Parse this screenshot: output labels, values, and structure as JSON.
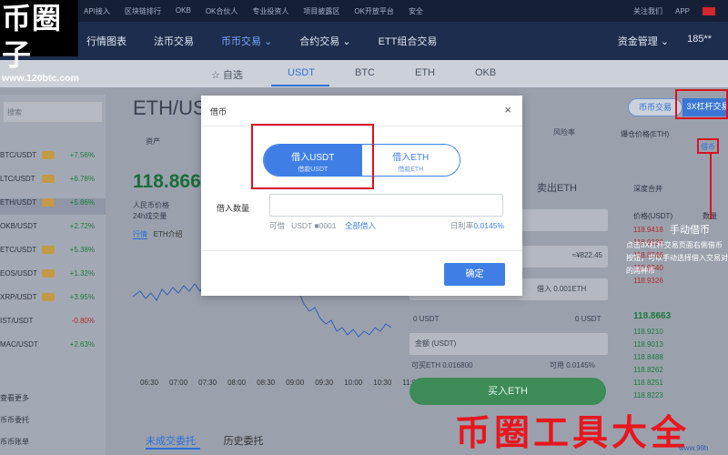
{
  "logo": {
    "big": "币圈子",
    "url": "www.120btc.com"
  },
  "topbar": {
    "links": [
      "API接入",
      "区块链排行",
      "OKB",
      "OK合伙人",
      "专业投资人",
      "项目披露区",
      "OK开放平台",
      "安全"
    ],
    "right": [
      "关注我们",
      "APP"
    ]
  },
  "nav": {
    "items": [
      "行情图表",
      "法币交易",
      "币币交易 ⌄",
      "合约交易 ⌄",
      "ETT组合交易"
    ],
    "active_index": 2,
    "right": [
      "资金管理 ⌄",
      "185**"
    ]
  },
  "subtabs": {
    "items": [
      "☆ 自选",
      "USDT",
      "BTC",
      "ETH",
      "OKB"
    ],
    "active_index": 1
  },
  "left": {
    "search": "搜索",
    "pairs": [
      {
        "name": "BTC/USDT",
        "badge": "3X",
        "change": "+7.56%",
        "dir": "up"
      },
      {
        "name": "LTC/USDT",
        "badge": "3X",
        "change": "+6.78%",
        "dir": "up"
      },
      {
        "name": "ETH/USDT",
        "badge": "3X",
        "change": "+5.86%",
        "dir": "up"
      },
      {
        "name": "OKB/USDT",
        "badge": "",
        "change": "+2.72%",
        "dir": "up"
      },
      {
        "name": "ETC/USDT",
        "badge": "3X",
        "change": "+5.38%",
        "dir": "up"
      },
      {
        "name": "EOS/USDT",
        "badge": "3X",
        "change": "+1.32%",
        "dir": "up"
      },
      {
        "name": "XRP/USDT",
        "badge": "3X",
        "change": "+3.95%",
        "dir": "up"
      },
      {
        "name": "IST/USDT",
        "badge": "",
        "change": "-0.80%",
        "dir": "dn"
      },
      {
        "name": "MAC/USDT",
        "badge": "",
        "change": "+2.63%",
        "dir": "up"
      }
    ],
    "bottom": [
      "查看更多",
      "币币委托",
      "币币账单"
    ]
  },
  "center": {
    "pair": "ETH/US",
    "label_asset": "资产",
    "price": "118.866",
    "label_rmb": "人民币价格",
    "label_vol": "24h成交量",
    "chart_tabs": [
      "行情",
      "ETH介绍"
    ],
    "times": [
      "06:30",
      "07:00",
      "07:30",
      "08:00",
      "08:30",
      "09:00",
      "09:30",
      "10:00",
      "10:30",
      "11:0"
    ],
    "bottom_tabs": [
      "未成交委托",
      "历史委托"
    ]
  },
  "right": {
    "risk": "风险率",
    "sell": "卖出ETH",
    "price": "≈¥822.45",
    "borrow_hint": "借入 0.001ETH",
    "usdt_line": "0 USDT",
    "usdt_line2": "0 USDT",
    "amount": "金额 (USDT)",
    "avail": "可买ETH 0.016800",
    "avail2": "可用 0.0145%",
    "buy": "买入ETH"
  },
  "far_right": {
    "pill_coin": "币币交易",
    "pill_lev": "3X杠杆交易",
    "explode": "爆仓价格(ETH)",
    "borrow_tag": "借币",
    "merge": "深度合并",
    "col_price": "价格(USDT)",
    "col_amt": "数量",
    "asks": [
      "118.9418",
      "118.9338",
      "118.8746",
      "118.9340",
      "118.9326"
    ],
    "mid": "118.8663",
    "bids": [
      "118.9210",
      "118.9013",
      "118.8488",
      "118.8262",
      "118.8251",
      "118.8223"
    ],
    "annot_title": "手动借币",
    "annot_text": "点击3X杠杆交易页面右侧借币按钮，可以手动选择借入交易对的两种币"
  },
  "modal": {
    "title": "借币",
    "close": "×",
    "opt1_main": "借入USDT",
    "opt1_sub": "借款USDT",
    "opt2_main": "借入ETH",
    "opt2_sub": "借款ETH",
    "amount_label": "借入数量",
    "amount_value": "",
    "avail_label": "可借",
    "avail_value": "USDT ■0001",
    "borrow_all": "全部借入",
    "rate_label": "日利率",
    "rate_value": "0.0145%",
    "confirm": "确定"
  },
  "banner": {
    "text": "币圈工具大全",
    "sub": "www.99h"
  }
}
